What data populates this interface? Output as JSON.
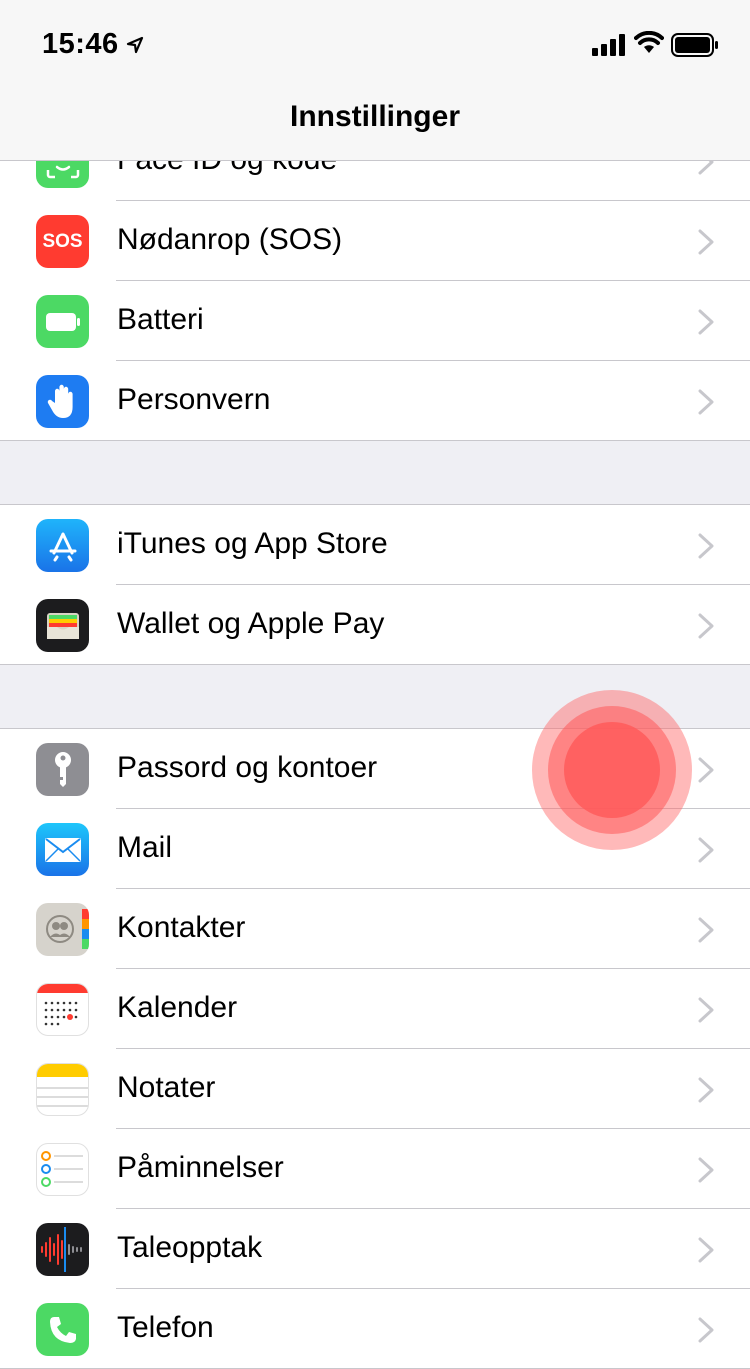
{
  "status_bar": {
    "time": "15:46"
  },
  "nav": {
    "title": "Innstillinger"
  },
  "groups": [
    {
      "items": [
        {
          "label": "Face ID og kode",
          "icon": "face-id-icon",
          "color": "#4cd964"
        },
        {
          "label": "Nødanrop (SOS)",
          "icon": "sos-icon",
          "color": "#ff3b30",
          "icon_text": "SOS"
        },
        {
          "label": "Batteri",
          "icon": "battery-settings-icon",
          "color": "#4cd964"
        },
        {
          "label": "Personvern",
          "icon": "hand-icon",
          "color": "#1e7cf2"
        }
      ]
    },
    {
      "items": [
        {
          "label": "iTunes og App Store",
          "icon": "app-store-icon",
          "color": "#2b8df7"
        },
        {
          "label": "Wallet og Apple Pay",
          "icon": "wallet-icon",
          "color": "#1c1c1e"
        }
      ]
    },
    {
      "items": [
        {
          "label": "Passord og kontoer",
          "icon": "key-icon",
          "color": "#8e8e93"
        },
        {
          "label": "Mail",
          "icon": "mail-icon",
          "color": "#2196f3"
        },
        {
          "label": "Kontakter",
          "icon": "contacts-icon",
          "color": "#d6d3cc"
        },
        {
          "label": "Kalender",
          "icon": "calendar-icon",
          "color": "#ffffff"
        },
        {
          "label": "Notater",
          "icon": "notes-icon",
          "color": "#ffffff"
        },
        {
          "label": "Påminnelser",
          "icon": "reminders-icon",
          "color": "#ffffff"
        },
        {
          "label": "Taleopptak",
          "icon": "voice-memos-icon",
          "color": "#1c1c1e"
        },
        {
          "label": "Telefon",
          "icon": "phone-icon",
          "color": "#4cd964"
        }
      ]
    }
  ]
}
